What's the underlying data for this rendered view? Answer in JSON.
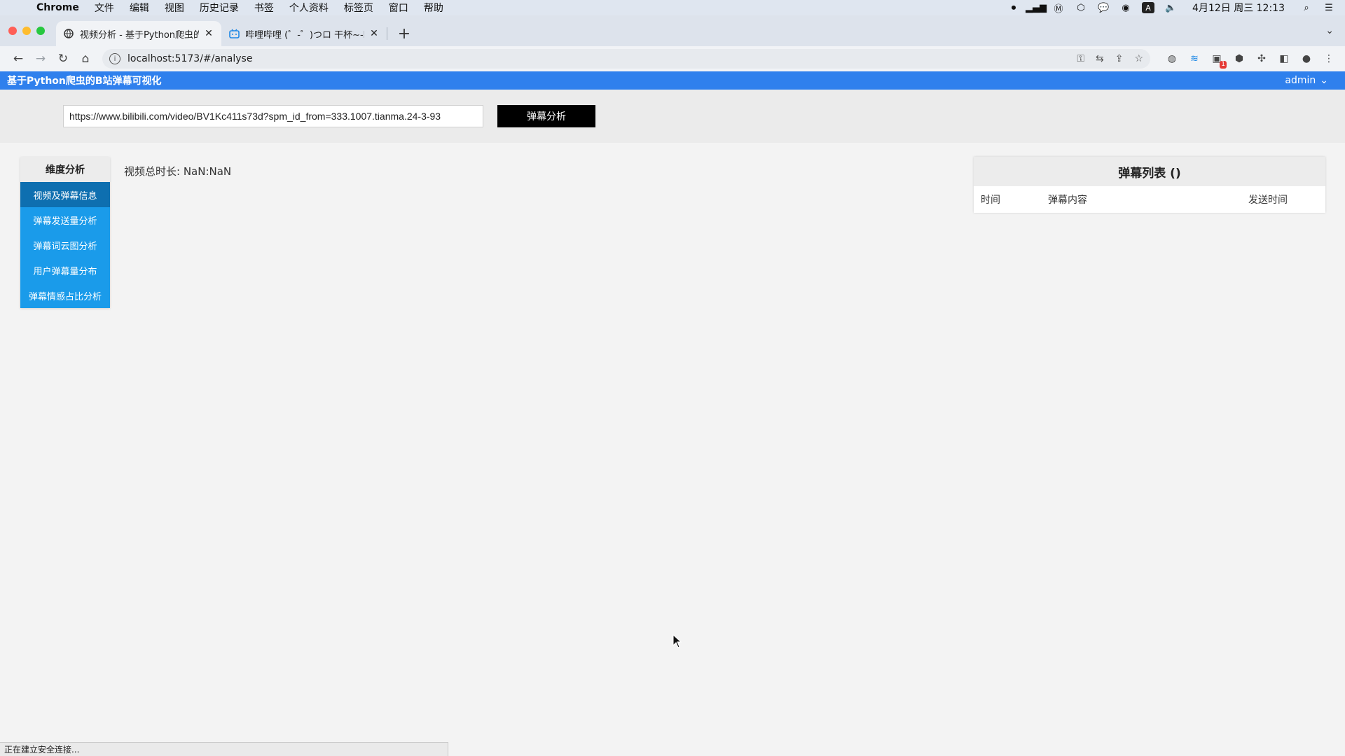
{
  "menubar": {
    "app": "Chrome",
    "items": [
      "文件",
      "编辑",
      "视图",
      "历史记录",
      "书签",
      "个人资料",
      "标签页",
      "窗口",
      "帮助"
    ],
    "clock": "4月12日 周三  12:13",
    "input_method": "A"
  },
  "tabs": [
    {
      "title": "视频分析 - 基于Python爬虫的B站",
      "icon": "globe-icon",
      "active": true
    },
    {
      "title": "哔哩哔哩 (゜-゜)つロ 干杯~-bili",
      "icon": "bilibili-icon",
      "active": false
    }
  ],
  "toolbar": {
    "url": "localhost:5173/#/analyse"
  },
  "app": {
    "title": "基于Python爬虫的B站弹幕可视化",
    "user": "admin",
    "accent_color": "#2f80ed"
  },
  "search": {
    "value": "https://www.bilibili.com/video/BV1Kc411s73d?spm_id_from=333.1007.tianma.24-3-93",
    "button_label": "弹幕分析"
  },
  "side_menu": {
    "title": "维度分析",
    "items": [
      "视频及弹幕信息",
      "弹幕发送量分析",
      "弹幕词云图分析",
      "用户弹幕量分布",
      "弹幕情感占比分析"
    ],
    "active_index": 0
  },
  "main": {
    "duration_label": "视频总时长: NaN:NaN"
  },
  "danmu_list": {
    "title": "弹幕列表 ()",
    "columns": [
      "时间",
      "弹幕内容",
      "发送时间"
    ]
  },
  "status": {
    "text": "正在建立安全连接..."
  }
}
